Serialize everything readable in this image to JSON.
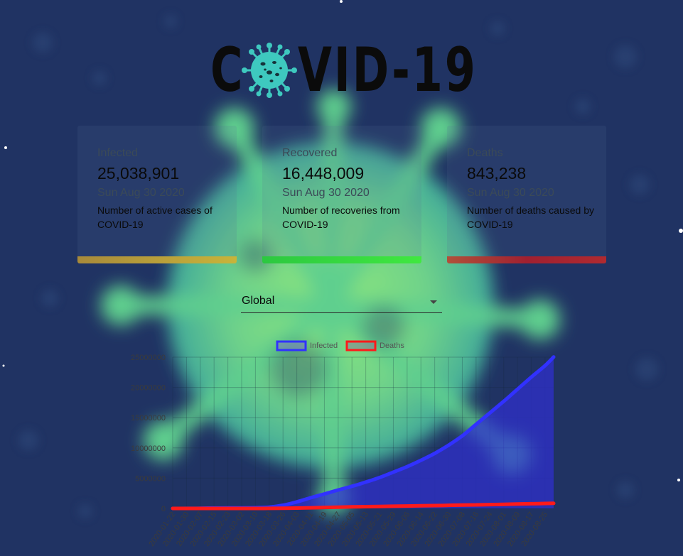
{
  "header": {
    "logo_text_left": "C",
    "logo_text_right": "VID-19",
    "logo_icon": "virus-icon"
  },
  "cards": [
    {
      "title": "Infected",
      "value": "25,038,901",
      "date": "Sun Aug 30 2020",
      "description": "Number of active cases of COVID-19",
      "bar_color": "#c8b43a"
    },
    {
      "title": "Recovered",
      "value": "16,448,009",
      "date": "Sun Aug 30 2020",
      "description": "Number of recoveries from COVID-19",
      "bar_color": "#38e040"
    },
    {
      "title": "Deaths",
      "value": "843,238",
      "date": "Sun Aug 30 2020",
      "description": "Number of deaths caused by COVID-19",
      "bar_color": "#b02a30"
    }
  ],
  "country_select": {
    "value": "Global",
    "icon": "dropdown-arrow-icon"
  },
  "colors": {
    "background": "#203363",
    "infected_line": "#3131ff",
    "infected_fill": "#2f2fd0",
    "deaths_line": "#ff1a1a"
  },
  "chart_data": {
    "type": "line",
    "title": "",
    "xlabel": "",
    "ylabel": "",
    "ylim": [
      0,
      25000000
    ],
    "yticks": [
      "0",
      "5000000",
      "10000000",
      "15000000",
      "20000000",
      "25000000"
    ],
    "legend_position": "top",
    "grid": true,
    "x": [
      "2020-01-22",
      "2020-01-30",
      "2020-02-07",
      "2020-02-15",
      "2020-02-23",
      "2020-03-02",
      "2020-03-10",
      "2020-03-18",
      "2020-03-26",
      "2020-04-03",
      "2020-04-11",
      "2020-04-19",
      "2020-04-27",
      "2020-05-05",
      "2020-05-13",
      "2020-05-21",
      "2020-05-29",
      "2020-06-06",
      "2020-06-14",
      "2020-06-22",
      "2020-06-30",
      "2020-07-08",
      "2020-07-16",
      "2020-07-24",
      "2020-08-01",
      "2020-08-09",
      "2020-08-17",
      "2020-08-25",
      "2020-08-30"
    ],
    "series": [
      {
        "name": "Infected",
        "values": [
          555,
          9900,
          34400,
          69000,
          79000,
          90000,
          118000,
          215000,
          530000,
          1080000,
          1760000,
          2400000,
          3050000,
          3660000,
          4350000,
          5100000,
          6000000,
          6900000,
          7950000,
          9100000,
          10450000,
          12000000,
          13900000,
          15800000,
          17700000,
          19700000,
          21700000,
          23600000,
          25038901
        ]
      },
      {
        "name": "Deaths",
        "values": [
          17,
          213,
          722,
          1667,
          2470,
          3120,
          4260,
          9270,
          27400,
          59000,
          108000,
          165000,
          211000,
          257000,
          297000,
          330000,
          365000,
          398000,
          432000,
          470000,
          512000,
          550000,
          592000,
          637000,
          682000,
          729000,
          779000,
          818000,
          843238
        ]
      }
    ]
  }
}
